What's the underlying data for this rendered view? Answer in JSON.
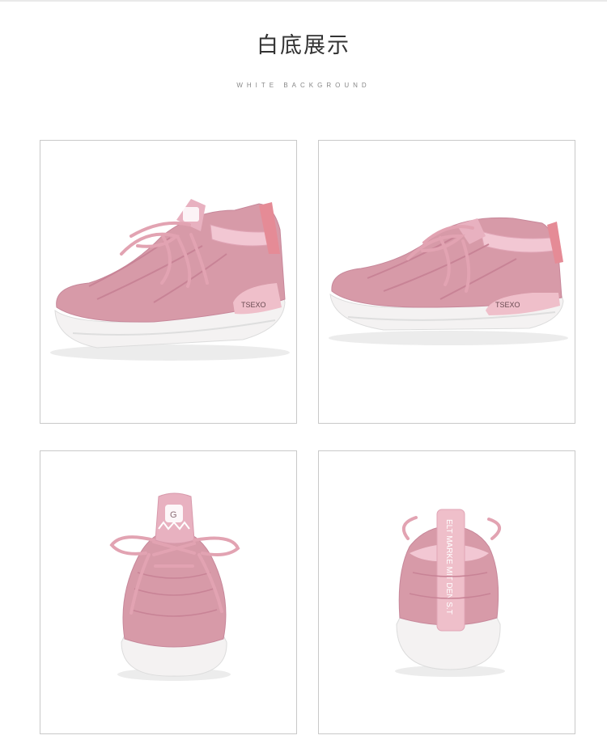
{
  "header": {
    "title": "白底展示",
    "subtitle": "WHITE BACKGROUND"
  },
  "gallery": {
    "items": [
      {
        "view": "side-view-left",
        "brand_text": "TSEXO"
      },
      {
        "view": "side-view-right",
        "brand_text": "TSEXO"
      },
      {
        "view": "front-view",
        "tongue_text": "G"
      },
      {
        "view": "rear-view",
        "heel_text": "ELT MARKE MIT DEN S.T"
      }
    ]
  },
  "colors": {
    "knit_pink": "#d79aa8",
    "lace_pink": "#e2a3b2",
    "sole_white": "#f4f2f2",
    "frame_border": "#c9c9c9"
  }
}
